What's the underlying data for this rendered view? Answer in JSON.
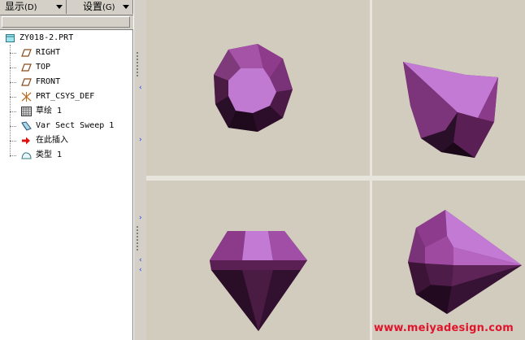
{
  "menu": {
    "display_label": "显示",
    "display_key": "(D)",
    "settings_label": "设置",
    "settings_key": "(G)"
  },
  "tree": {
    "root": "ZY018-2.PRT",
    "items": [
      {
        "label": "RIGHT",
        "icon": "datum-plane-icon"
      },
      {
        "label": "TOP",
        "icon": "datum-plane-icon"
      },
      {
        "label": "FRONT",
        "icon": "datum-plane-icon"
      },
      {
        "label": "PRT_CSYS_DEF",
        "icon": "coordinate-system-icon"
      },
      {
        "label": "草绘 1",
        "icon": "sketch-icon"
      },
      {
        "label": "Var Sect Sweep 1",
        "icon": "sweep-feature-icon"
      },
      {
        "label": "在此插入",
        "icon": "insert-here-arrow-icon"
      },
      {
        "label": "类型 1",
        "icon": "style-feature-icon"
      }
    ]
  },
  "colors": {
    "gem_light": "#c87ad6",
    "gem_mid": "#9a3f96",
    "gem_dark": "#3a1530",
    "viewport_bg": "#d1ccbd",
    "watermark": "#e0142c",
    "sash_arrow": "#1c3bd8"
  },
  "watermark": "www.meiyadesign.com"
}
